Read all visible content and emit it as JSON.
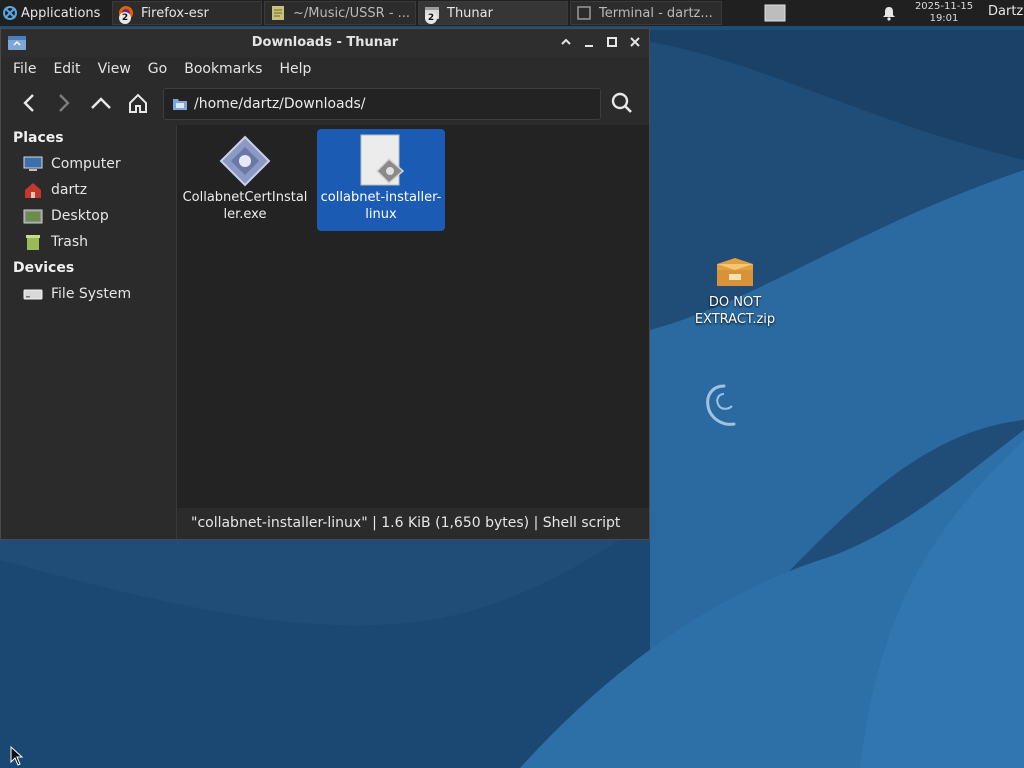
{
  "panel": {
    "applications_label": "Applications",
    "tasks": [
      {
        "label": "Firefox-esr",
        "badge": "2"
      },
      {
        "label": "~/Music/USSR - ..."
      },
      {
        "label": "Thunar",
        "badge": "2"
      },
      {
        "label": "Terminal - dartz..."
      }
    ],
    "clock": {
      "date": "2025-11-15",
      "time": "19:01"
    },
    "user": "Dartz"
  },
  "desktop": {
    "icons": [
      {
        "label_line1": "DO NOT",
        "label_line2": "EXTRACT.zip"
      }
    ]
  },
  "window": {
    "title": "Downloads - Thunar",
    "menu": [
      "File",
      "Edit",
      "View",
      "Go",
      "Bookmarks",
      "Help"
    ],
    "location": "/home/dartz/Downloads/",
    "sidebar": {
      "places_heading": "Places",
      "places": [
        "Computer",
        "dartz",
        "Desktop",
        "Trash"
      ],
      "devices_heading": "Devices",
      "devices": [
        "File System"
      ]
    },
    "files": [
      {
        "line1": "CollabnetCertInstal",
        "line2": "ler.exe",
        "selected": false
      },
      {
        "line1": "collabnet-installer-",
        "line2": "linux",
        "selected": true
      }
    ],
    "status": "\"collabnet-installer-linux\"  |  1.6 KiB (1,650 bytes)  |  Shell script"
  },
  "colors": {
    "selection": "#1b5bb3",
    "desktop": "#1e4c75",
    "panel": "#202020"
  }
}
